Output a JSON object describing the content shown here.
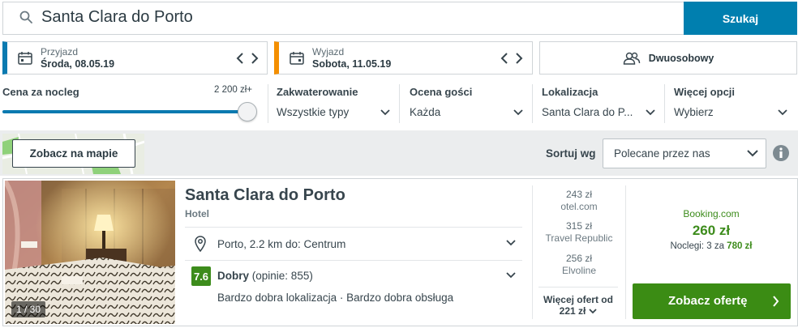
{
  "search": {
    "query": "Santa Clara do Porto",
    "button_label": "Szukaj"
  },
  "dates": {
    "checkin": {
      "label": "Przyjazd",
      "value": "Środa, 08.05.19"
    },
    "checkout": {
      "label": "Wyjazd",
      "value": "Sobota, 11.05.19"
    }
  },
  "guests": {
    "label": "Dwuosobowy"
  },
  "filters": {
    "price": {
      "label": "Cena za nocleg",
      "max_label": "2 200 zł+",
      "slider_fraction": 1.0
    },
    "accommodation": {
      "label": "Zakwaterowanie",
      "value": "Wszystkie typy"
    },
    "rating": {
      "label": "Ocena gości",
      "value": "Każda"
    },
    "location": {
      "label": "Lokalizacja",
      "value": "Santa Clara do P..."
    },
    "more": {
      "label": "Więcej opcji",
      "value": "Wybierz"
    }
  },
  "toolbar": {
    "map_button": "Zobacz na mapie",
    "sort_label": "Sortuj wg",
    "sort_value": "Polecane przez nas"
  },
  "result": {
    "photo_counter": "1 / 30",
    "name": "Santa Clara do Porto",
    "type": "Hotel",
    "location": "Porto, 2.2 km do: Centrum",
    "rating_score": "7.6",
    "rating_word": "Dobry",
    "rating_count": "(opinie: 855)",
    "highlights": "Bardzo dobra lokalizacja · Bardzo dobra obsługa",
    "offers": [
      {
        "price": "243 zł",
        "provider": "otel.com"
      },
      {
        "price": "315 zł",
        "provider": "Travel Republic"
      },
      {
        "price": "256 zł",
        "provider": "Elvoline"
      }
    ],
    "more_offers_label": "Więcej ofert od",
    "more_offers_price": "221 zł",
    "best": {
      "provider": "Booking.com",
      "price": "260 zł",
      "nights_text": "Noclegi: 3 za",
      "total": "780 zł",
      "button_label": "Zobacz ofertę"
    }
  },
  "colors": {
    "accent_blue": "#007faf",
    "checkout_orange": "#f48f00",
    "deal_green": "#3b8c14",
    "rating_green": "#3d8c1c"
  }
}
